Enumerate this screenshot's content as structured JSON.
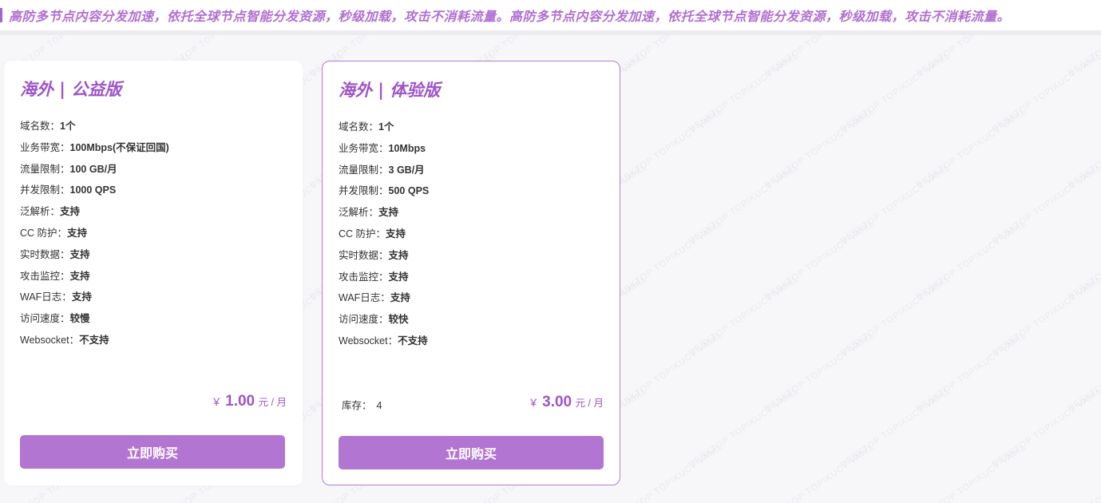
{
  "marquee": {
    "text": "高防多节点内容分发加速，依托全球节点智能分发资源，秒级加载，攻击不消耗流量。高防多节点内容分发加速，依托全球节点智能分发资源，秒级加载，攻击不消耗流量。"
  },
  "watermark": "DESKTOP TOPIKUCT VAIKL",
  "colors": {
    "accent": "#9e55c8",
    "button": "#b276d2",
    "marquee": "#b06fd2"
  },
  "plans": [
    {
      "title": "海外 | 公益版",
      "specs": [
        {
          "label": "域名数：",
          "value": "1个"
        },
        {
          "label": "业务带宽：",
          "value": "100Mbps(不保证回国)"
        },
        {
          "label": "流量限制：",
          "value": "100 GB/月"
        },
        {
          "label": "并发限制：",
          "value": "1000 QPS"
        },
        {
          "label": "泛解析：",
          "value": "支持"
        },
        {
          "label": "CC 防护：",
          "value": "支持"
        },
        {
          "label": "实时数据：",
          "value": "支持"
        },
        {
          "label": "攻击监控：",
          "value": "支持"
        },
        {
          "label": "WAF日志：",
          "value": "支持"
        },
        {
          "label": "访问速度：",
          "value": "较慢"
        },
        {
          "label": "Websocket：",
          "value": "不支持"
        }
      ],
      "stock_label": "",
      "stock_value": "",
      "price_currency": "￥",
      "price_amount": "1.00",
      "price_unit": "元 / 月",
      "buy_label": "立即购买"
    },
    {
      "title": "海外 | 体验版",
      "specs": [
        {
          "label": "域名数：",
          "value": "1个"
        },
        {
          "label": "业务带宽：",
          "value": "10Mbps"
        },
        {
          "label": "流量限制：",
          "value": "3 GB/月"
        },
        {
          "label": "并发限制：",
          "value": "500 QPS"
        },
        {
          "label": "泛解析：",
          "value": "支持"
        },
        {
          "label": "CC 防护：",
          "value": "支持"
        },
        {
          "label": "实时数据：",
          "value": "支持"
        },
        {
          "label": "攻击监控：",
          "value": "支持"
        },
        {
          "label": "WAF日志：",
          "value": "支持"
        },
        {
          "label": "访问速度：",
          "value": "较快"
        },
        {
          "label": "Websocket：",
          "value": "不支持"
        }
      ],
      "stock_label": "库存：",
      "stock_value": "4",
      "price_currency": "￥",
      "price_amount": "3.00",
      "price_unit": "元 / 月",
      "buy_label": "立即购买"
    }
  ]
}
